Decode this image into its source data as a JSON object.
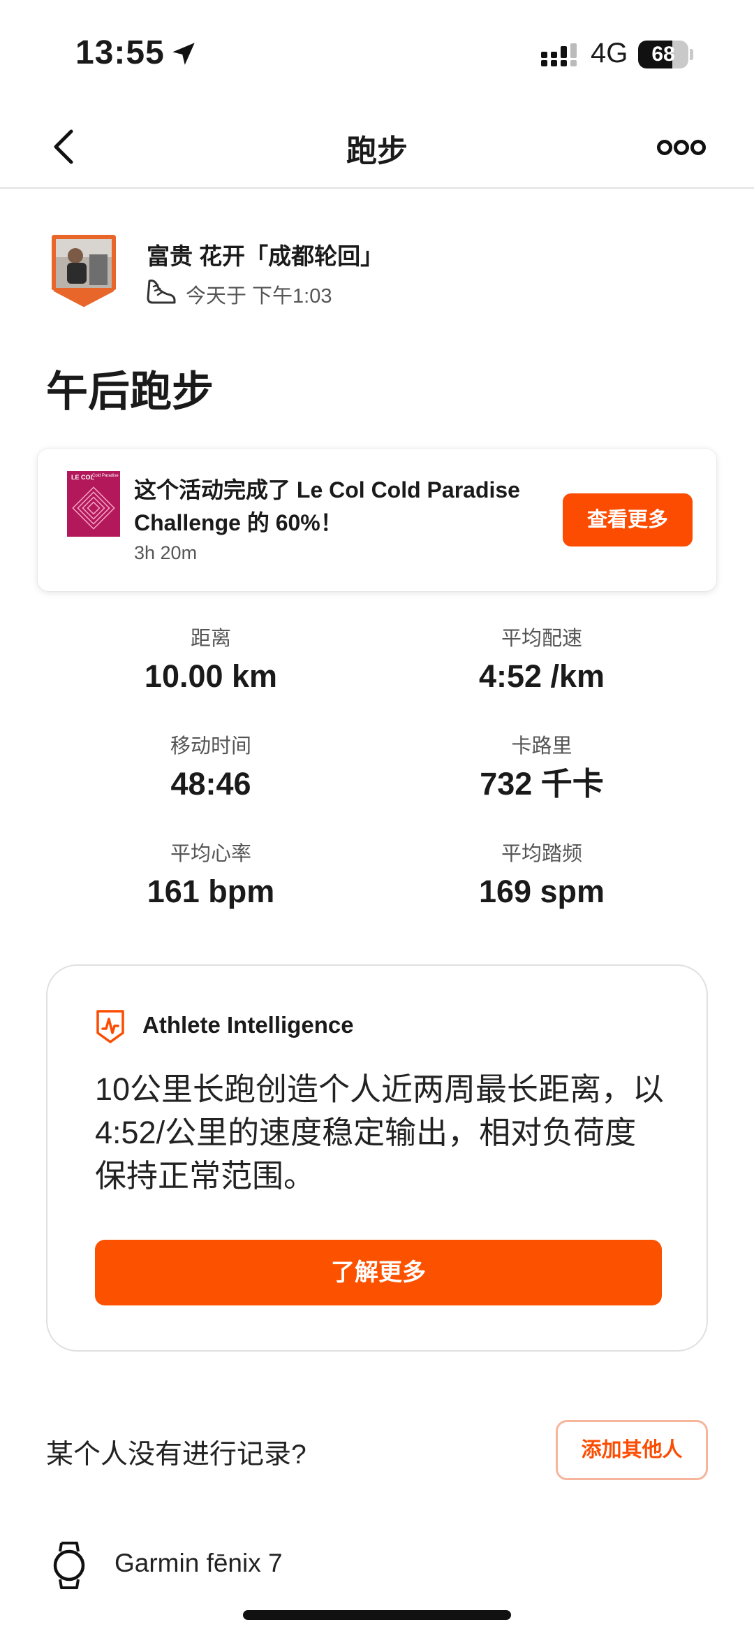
{
  "status_bar": {
    "time": "13:55",
    "network": "4G",
    "battery_level": 68,
    "battery_text": "68",
    "location_icon": "location-arrow-icon",
    "signal_icon": "cellular-signal-icon"
  },
  "nav": {
    "title": "跑步",
    "back_icon": "chevron-left-icon",
    "more_icon": "more-dots-icon"
  },
  "athlete": {
    "name": "富贵 花开「成都轮回」",
    "activity_time": "今天于 下午1:03",
    "sport_icon": "running-shoe-icon"
  },
  "activity_title": "午后跑步",
  "challenge": {
    "thumbnail_text": "LE COL",
    "thumbnail_subtext": "Cold Paradise",
    "text": "这个活动完成了 Le Col Cold Paradise Challenge 的 60%！",
    "progress_percent": 60,
    "duration": "3h 20m",
    "button_label": "查看更多"
  },
  "stats": [
    {
      "label": "距离",
      "value": "10.00 km"
    },
    {
      "label": "平均配速",
      "value": "4:52 /km"
    },
    {
      "label": "移动时间",
      "value": "48:46"
    },
    {
      "label": "卡路里",
      "value": "732 千卡"
    },
    {
      "label": "平均心率",
      "value": "161 bpm"
    },
    {
      "label": "平均踏频",
      "value": "169 spm"
    }
  ],
  "athlete_intelligence": {
    "icon": "athlete-intelligence-icon",
    "title": "Athlete Intelligence",
    "summary": "10公里长跑创造个人近两周最长距离，以4:52/公里的速度稳定输出，相对负荷度保持正常范围。",
    "button_label": "了解更多"
  },
  "missing_record": {
    "text": "某个人没有进行记录?",
    "button_label": "添加其他人"
  },
  "device": {
    "icon": "watch-icon",
    "name": "Garmin fēnix 7"
  },
  "colors": {
    "accent": "#fc4c02",
    "accent_button": "#fc5200",
    "add_button_border": "#f6b59c",
    "challenge_thumb": "#b3185a"
  }
}
